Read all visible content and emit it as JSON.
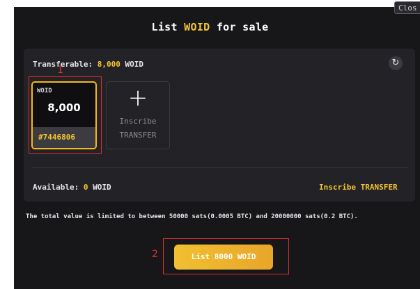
{
  "close_button": {
    "label": "Clos"
  },
  "title": {
    "prefix": "List ",
    "ticker": "WOID",
    "suffix": " for sale"
  },
  "balance": {
    "transferable_label": "Transferable: ",
    "transferable_amount": "8,000",
    "transferable_unit": " WOID",
    "available_label": "Available: ",
    "available_amount": "0",
    "available_unit": " WOID",
    "inscribe_link": "Inscribe TRANSFER"
  },
  "transfer_card": {
    "ticker": "WOID",
    "amount": "8,000",
    "inscription_id": "#7446806"
  },
  "inscribe_card": {
    "line1": "Inscribe",
    "line2": "TRANSFER"
  },
  "notice": "The total value is limited to between 50000 sats(0.0005 BTC) and 20000000 sats(0.2 BTC).",
  "list_button": {
    "label": "List 8000 WOID"
  },
  "annotations": {
    "one": "1",
    "two": "2"
  },
  "icons": {
    "refresh": "refresh-icon",
    "plus": "plus-icon"
  },
  "colors": {
    "accent": "#f4c430",
    "background": "#17171a",
    "panel": "#232327",
    "highlight": "#e03030"
  }
}
